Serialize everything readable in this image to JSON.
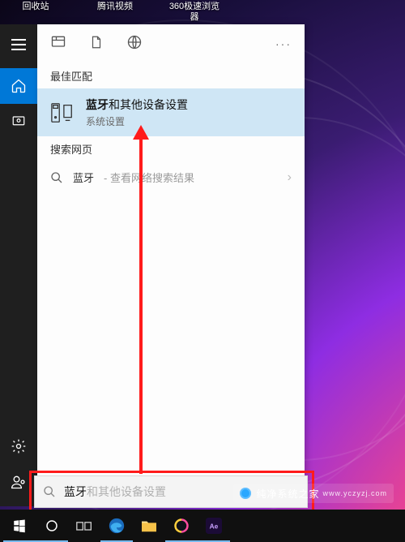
{
  "desktop": {
    "icons": [
      {
        "label": "回收站"
      },
      {
        "label": "腾讯视频"
      },
      {
        "label": "360极速浏览\n器"
      }
    ]
  },
  "panel": {
    "scopes": {
      "more": "···"
    },
    "best_match_header": "最佳匹配",
    "best_match": {
      "title_bold": "蓝牙",
      "title_rest": "和其他设备设置",
      "subtitle": "系统设置"
    },
    "web_header": "搜索网页",
    "web_result": {
      "query": "蓝牙",
      "suffix": " - 查看网络搜索结果"
    }
  },
  "search": {
    "typed": "蓝牙",
    "ghost": "和其他设备设置"
  },
  "watermark": {
    "text": "纯净系统之家",
    "url": "www.yczyzj.com"
  }
}
